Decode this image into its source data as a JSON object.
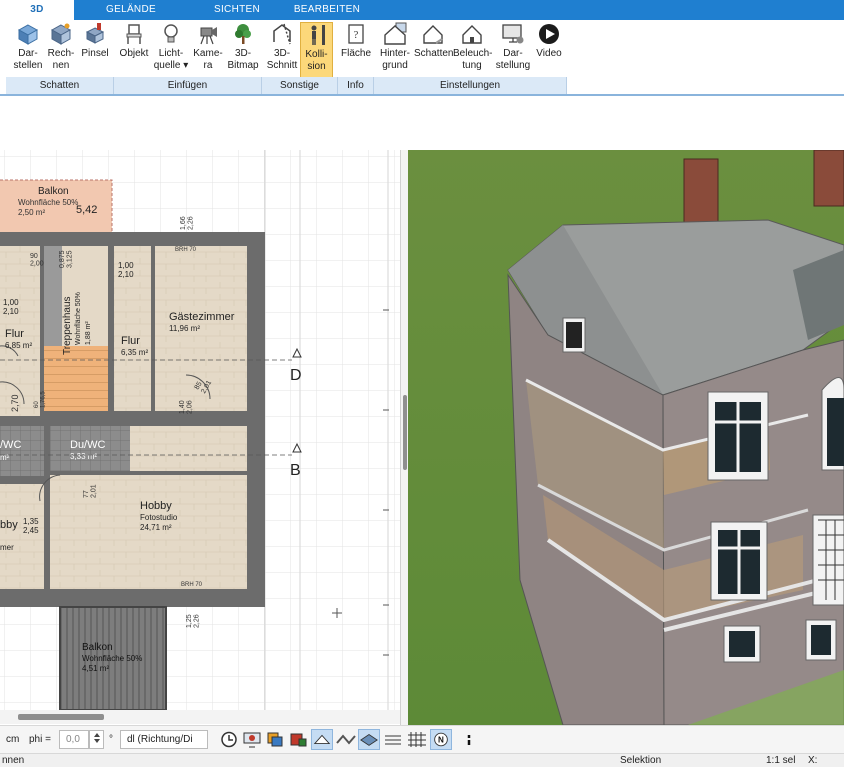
{
  "tabs": [
    {
      "label": "3D",
      "active": true
    },
    {
      "label": "GELÄNDE"
    },
    {
      "label": "SICHTEN"
    },
    {
      "label": "BEARBEITEN"
    }
  ],
  "ribbon": {
    "buttons": [
      {
        "label": "Dar-\nstellen",
        "icon": "cube-icon"
      },
      {
        "label": "Rech-\nnen",
        "icon": "cube-render-icon"
      },
      {
        "label": "Pinsel",
        "icon": "brush-icon"
      },
      {
        "label": "Objekt",
        "icon": "chair-icon"
      },
      {
        "label": "Licht-\nquelle ▾",
        "icon": "lightbulb-icon"
      },
      {
        "label": "Kame-\nra",
        "icon": "camera-icon"
      },
      {
        "label": "3D-\nBitmap",
        "icon": "tree-icon"
      },
      {
        "label": "3D-\nSchnitt",
        "icon": "section-cut-icon"
      },
      {
        "label": "Kolli-\nsion",
        "icon": "collision-icon",
        "active": true
      },
      {
        "label": "Fläche",
        "icon": "area-info-icon"
      },
      {
        "label": "Hinter-\ngrund",
        "icon": "house-background-icon"
      },
      {
        "label": "Schatten",
        "icon": "house-shadow-icon"
      },
      {
        "label": "Beleuch-\ntung",
        "icon": "house-light-icon"
      },
      {
        "label": "Dar-\nstellung",
        "icon": "display-settings-icon"
      },
      {
        "label": "Video",
        "icon": "play-icon"
      }
    ],
    "groups": [
      "Schatten",
      "Einfügen",
      "Sonstige",
      "Info",
      "Einstellungen"
    ]
  },
  "plan": {
    "rooms": [
      {
        "name": "Balkon",
        "sub": "Wohnfläche  50%",
        "area": "2,50 m²",
        "extra": "5,42"
      },
      {
        "name": "Flur",
        "area": "6,85 m²",
        "dim": "1,00\n2,10"
      },
      {
        "name": "Treppenhaus",
        "sub": "Wohnfläche 50%",
        "area": "1,88 m²"
      },
      {
        "name": "Flur",
        "area": "6,35 m²",
        "dim": "1,00\n2,10"
      },
      {
        "name": "Gästezimmer",
        "area": "11,96 m²"
      },
      {
        "name": "/WC",
        "area": "m²"
      },
      {
        "name": "Du/WC",
        "area": "3,33 m²"
      },
      {
        "name": "Hobby",
        "sub": "Fotostudio",
        "area": "24,71 m²"
      },
      {
        "name": "bby",
        "sub": "mer",
        "dim": "1,35\n2,45"
      },
      {
        "name": "Balkon",
        "sub": "Wohnfläche  50%",
        "area": "4,51 m²"
      }
    ],
    "markers": [
      "D",
      "B"
    ],
    "dims": [
      "1,66\n2,26",
      "90\n2,00",
      "0,875\n3,125",
      "BRH 70",
      "BRH 70",
      "85\n2,01",
      "1,40\n2,06",
      "77\n2,01",
      "1,25\n2,26",
      "2,70",
      "60\n1,76,5",
      "1,35\n2,45"
    ]
  },
  "bottombar": {
    "unit": "cm",
    "phi_label": "phi =",
    "phi_value": "0,0",
    "degree": "°",
    "direction": "dl (Richtung/Di",
    "icons": [
      "clock-icon",
      "screen-icon",
      "layers-icon",
      "paint-icon",
      "pencil-icon",
      "walls-icon",
      "plane-icon",
      "stack-icon",
      "grid-icon",
      "north-icon",
      "more-icon"
    ]
  },
  "statusbar": {
    "left": "nnen",
    "mode": "Selektion",
    "scale": "1:1 sel",
    "x_label": "X:"
  },
  "colors": {
    "accent": "#1f7fd0",
    "active_button": "#fcd87a",
    "grass": "#6b8f3f",
    "wall": "#6c6c6c",
    "floor": "#e3d8c6",
    "balcony": "#f2c8b0"
  }
}
